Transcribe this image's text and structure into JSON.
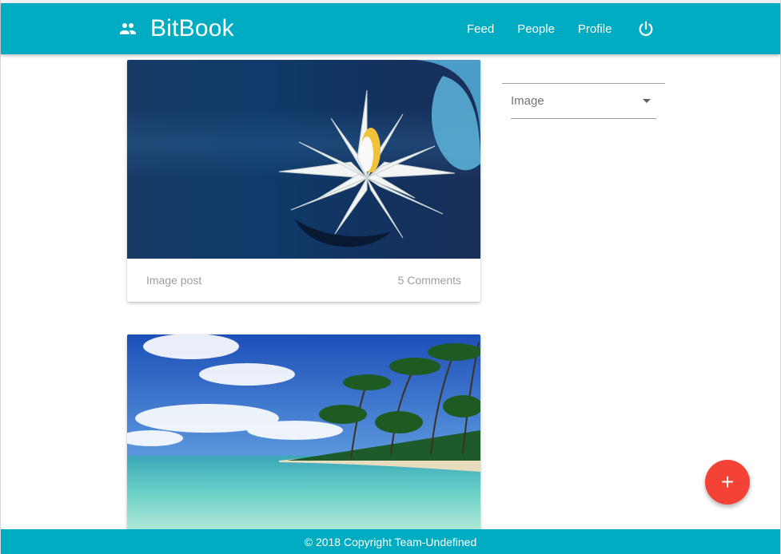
{
  "navbar": {
    "brand": "BitBook",
    "brand_icon": "people-icon",
    "links": [
      "Feed",
      "People",
      "Profile"
    ],
    "logout_icon": "power-icon",
    "color": "#00acc1"
  },
  "posts": [
    {
      "image": "water lily on dark blue water",
      "type_label": "Image post",
      "comments_label": "5 Comments"
    },
    {
      "image": "tropical beach with palm trees and turquoise sea"
    }
  ],
  "filter": {
    "selected": "Image"
  },
  "fab": {
    "icon": "plus-icon",
    "label": "+",
    "color": "#f44336"
  },
  "footer": {
    "text": "© 2018 Copyright Team-Undefined"
  }
}
